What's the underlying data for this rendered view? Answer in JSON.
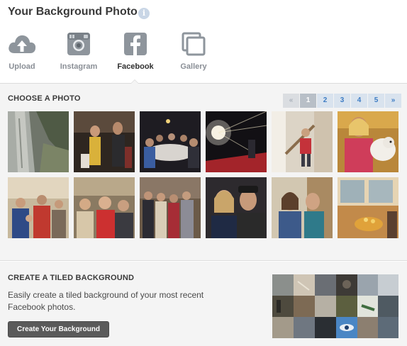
{
  "header": {
    "title": "Your Background Photo",
    "info_icon": "i"
  },
  "tabs": [
    {
      "label": "Upload",
      "icon": "cloud-upload-icon",
      "active": false
    },
    {
      "label": "Instagram",
      "icon": "instagram-icon",
      "active": false
    },
    {
      "label": "Facebook",
      "icon": "facebook-icon",
      "active": true
    },
    {
      "label": "Gallery",
      "icon": "gallery-icon",
      "active": false
    }
  ],
  "choose": {
    "title": "CHOOSE A PHOTO",
    "pager": {
      "first": "«",
      "pages": [
        "1",
        "2",
        "3",
        "4",
        "5"
      ],
      "last": "»",
      "active": "1"
    }
  },
  "tiled": {
    "title": "CREATE A TILED BACKGROUND",
    "description": "Easily create a tiled background of your most recent Facebook photos.",
    "button_label": "Create Your Background"
  },
  "colors": {
    "accent": "#3d7cc4",
    "icon_grey": "#8e959c",
    "section_bg": "#f4f4f4",
    "button_bg": "#5a5a5a"
  }
}
